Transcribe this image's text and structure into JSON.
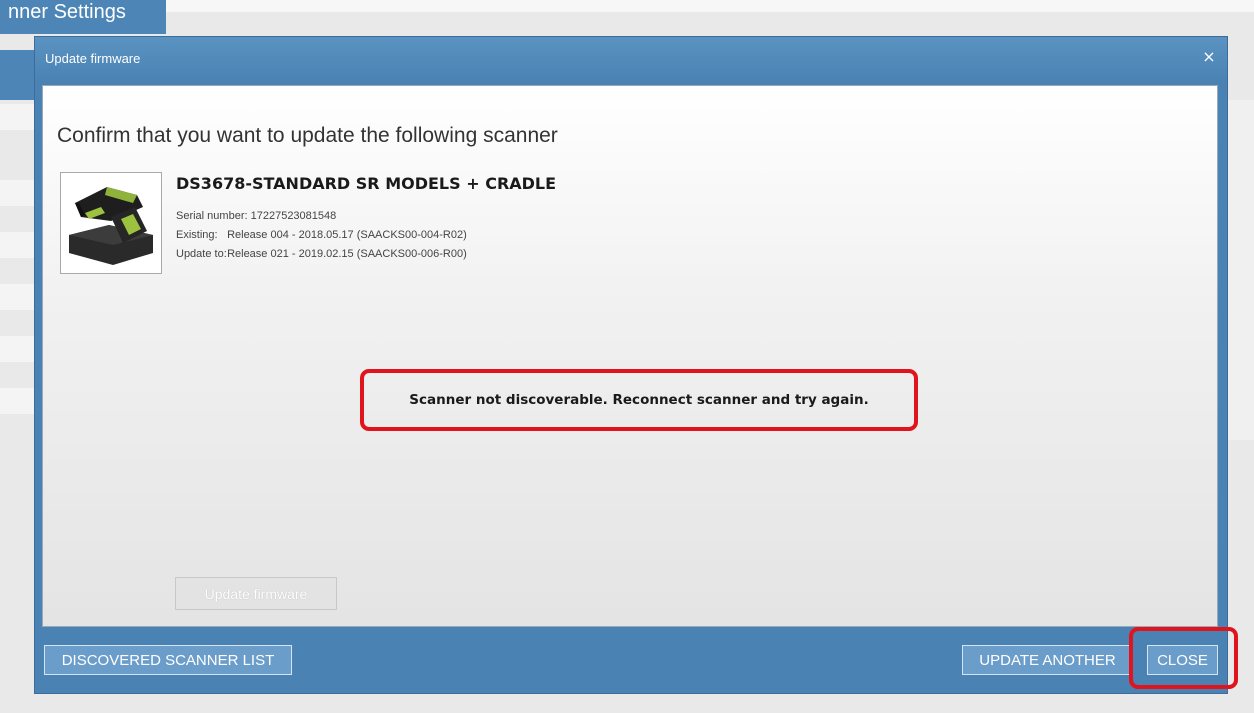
{
  "background": {
    "tab_label": "nner Settings"
  },
  "dialog": {
    "title": "Update firmware",
    "close_glyph": "×",
    "heading": "Confirm that you want to update the following scanner",
    "scanner": {
      "model": "DS3678-STANDARD SR MODELS + CRADLE",
      "serial_label": "Serial number:",
      "serial_value": "17227523081548",
      "existing_label": "Existing:",
      "existing_value": "Release 004 - 2018.05.17 (SAACKS00-004-R02)",
      "update_label": "Update to:",
      "update_value": "Release 021 - 2019.02.15 (SAACKS00-006-R00)",
      "image_icon": "barcode-scanner-icon"
    },
    "error_message": "Scanner not discoverable. Reconnect scanner and try again.",
    "update_button": "Update firmware",
    "footer": {
      "discovered_button": "DISCOVERED SCANNER LIST",
      "update_another_button": "UPDATE ANOTHER",
      "close_button": "CLOSE"
    }
  },
  "colors": {
    "accent_blue": "#4a82b3",
    "button_blue": "#6b9dca",
    "highlight_red": "#e0141c"
  }
}
